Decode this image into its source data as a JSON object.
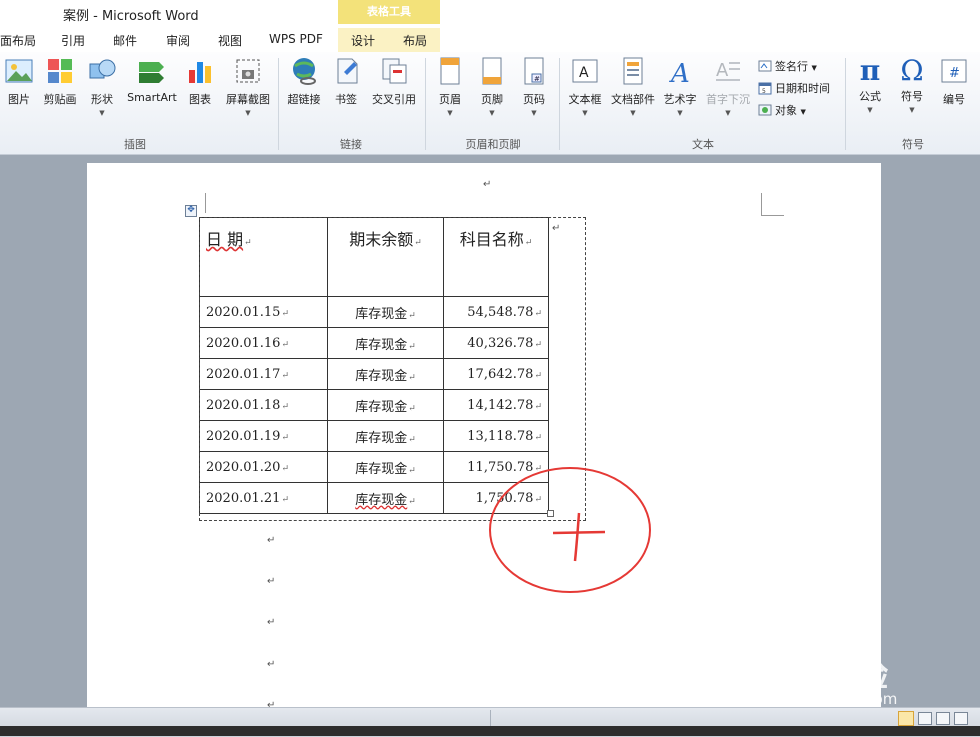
{
  "window": {
    "title": "案例  -  Microsoft Word",
    "tools_header": "表格工具"
  },
  "tabs": [
    "面布局",
    "引用",
    "邮件",
    "审阅",
    "视图",
    "WPS PDF",
    "设计",
    "布局"
  ],
  "ribbon": {
    "groups": {
      "illustrations": "插图",
      "links": "链接",
      "header_footer": "页眉和页脚",
      "text": "文本",
      "symbols": "符号"
    },
    "buttons": {
      "picture": "图片",
      "clipart": "剪贴画",
      "shapes": "形状",
      "smartart": "SmartArt",
      "chart": "图表",
      "screenshot": "屏幕截图",
      "hyperlink": "超链接",
      "bookmark": "书签",
      "crossref": "交叉引用",
      "header": "页眉",
      "footer": "页脚",
      "pagenum": "页码",
      "textbox": "文本框",
      "quickparts": "文档部件",
      "wordart": "艺术字",
      "dropcap": "首字下沉",
      "signature": "签名行",
      "datetime": "日期和时间",
      "object": "对象",
      "equation": "公式",
      "symbol": "符号",
      "number": "编号"
    }
  },
  "table": {
    "headers": [
      "日 期",
      "期末余额",
      "科目名称"
    ],
    "rows": [
      [
        "2020.01.15",
        "库存现金",
        "54,548.78"
      ],
      [
        "2020.01.16",
        "库存现金",
        "40,326.78"
      ],
      [
        "2020.01.17",
        "库存现金",
        "17,642.78"
      ],
      [
        "2020.01.18",
        "库存现金",
        "14,142.78"
      ],
      [
        "2020.01.19",
        "库存现金",
        "13,118.78"
      ],
      [
        "2020.01.20",
        "库存现金",
        "11,750.78"
      ],
      [
        "2020.01.21",
        "库存现金",
        "1,750.78"
      ]
    ]
  },
  "watermark": {
    "brand": "Bai 经验",
    "url": "jingyan.baidu.com"
  },
  "colors": {
    "annotation": "#e53935",
    "tools_tab": "#f3e27a"
  }
}
